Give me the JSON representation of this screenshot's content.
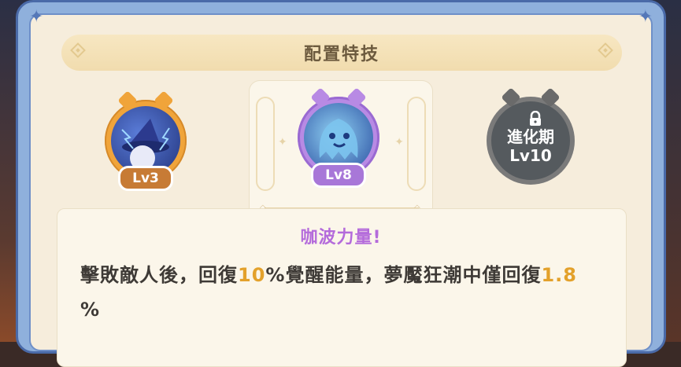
{
  "panel": {
    "title": "配置特技"
  },
  "skills": [
    {
      "level_label": "Lv3",
      "state": "unlocked",
      "accent_color": "#f0a43a"
    },
    {
      "level_label": "Lv8",
      "state": "selected",
      "accent_color": "#b88ae4"
    },
    {
      "lock_label_line1": "進化期",
      "lock_label_line2": "Lv10",
      "state": "locked",
      "icon": "lock-icon"
    }
  ],
  "description": {
    "skill_name": "咖波力量!",
    "text_part1": "擊敗敵人後，回復",
    "highlight1": "10",
    "text_part2": "%覺醒能量，夢魘狂潮中僅回復",
    "highlight2": "1.8",
    "text_part3": "%",
    "highlight_color": "#e3a12b",
    "name_color": "#b46bdb"
  }
}
